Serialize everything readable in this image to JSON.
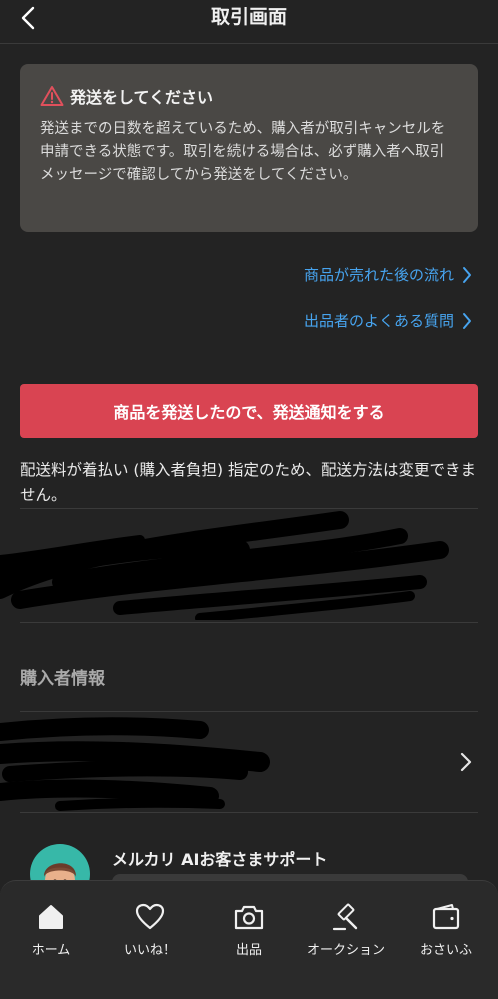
{
  "header": {
    "title": "取引画面"
  },
  "warning": {
    "title": "発送をしてください",
    "body": "発送までの日数を超えているため、購入者が取引キャンセルを申請できる状態です。取引を続ける場合は、必ず購入者へ取引メッセージで確認してから発送をしてください。"
  },
  "links": {
    "flow": "商品が売れた後の流れ",
    "faq": "出品者のよくある質問"
  },
  "action": {
    "ship_button": "商品を発送したので、発送通知をする"
  },
  "shipping_note": "配送料が着払い (購入者負担) 指定のため、配送方法は変更できません。",
  "buyer_section": {
    "title": "購入者情報"
  },
  "ai_support": {
    "title": "メルカリ AIお客さまサポート"
  },
  "nav": {
    "items": [
      {
        "label": "ホーム",
        "icon": "home-icon"
      },
      {
        "label": "いいね！",
        "icon": "heart-icon"
      },
      {
        "label": "出品",
        "icon": "camera-icon"
      },
      {
        "label": "オークション",
        "icon": "gavel-icon"
      },
      {
        "label": "おさいふ",
        "icon": "wallet-icon"
      }
    ]
  },
  "colors": {
    "background": "#232323",
    "warning_bg": "#4a4845",
    "accent_red": "#d94452",
    "link_blue": "#47a4ef",
    "warning_icon": "#e0505c"
  }
}
